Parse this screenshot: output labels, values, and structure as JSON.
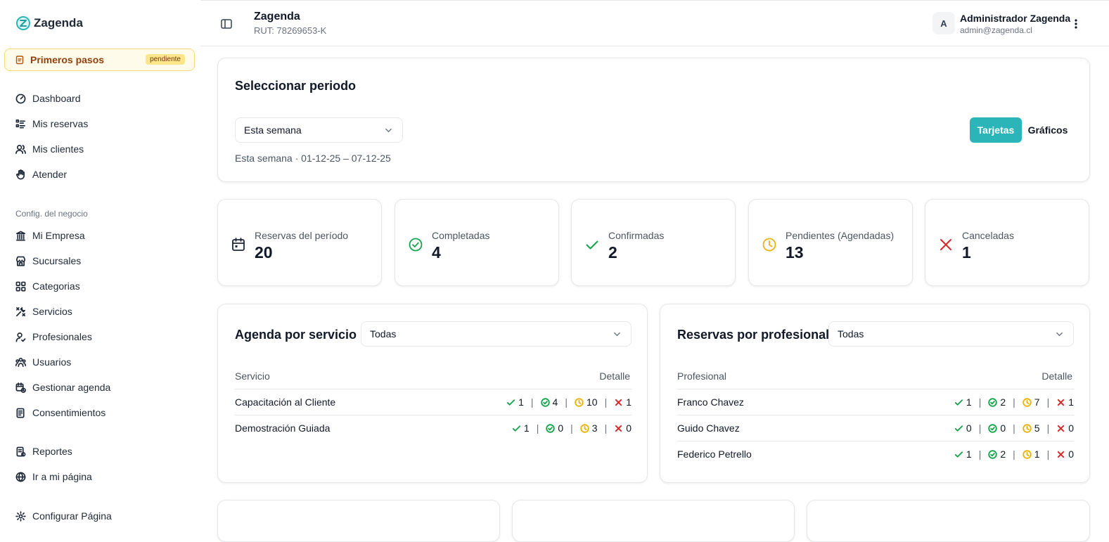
{
  "app": {
    "logo_text": "Zagenda"
  },
  "sidebar": {
    "first_steps": {
      "label": "Primeros pasos",
      "badge": "pendiente"
    },
    "main_items": [
      {
        "label": "Dashboard",
        "icon": "gauge-icon"
      },
      {
        "label": "Mis reservas",
        "icon": "list-icon"
      },
      {
        "label": "Mis clientes",
        "icon": "users-icon"
      },
      {
        "label": "Atender",
        "icon": "hand-icon"
      }
    ],
    "config_label": "Config. del negocio",
    "config_items": [
      {
        "label": "Mi Empresa",
        "icon": "building-icon"
      },
      {
        "label": "Sucursales",
        "icon": "store-icon"
      },
      {
        "label": "Categorias",
        "icon": "grid-icon"
      },
      {
        "label": "Servicios",
        "icon": "tools-icon"
      },
      {
        "label": "Profesionales",
        "icon": "user-check-icon"
      },
      {
        "label": "Usuarios",
        "icon": "people-icon"
      },
      {
        "label": "Gestionar agenda",
        "icon": "calendar-clock-icon"
      },
      {
        "label": "Consentimientos",
        "icon": "document-icon"
      }
    ],
    "bottom_items": [
      {
        "label": "Reportes",
        "icon": "report-icon"
      },
      {
        "label": "Ir a mi página",
        "icon": "globe-icon"
      },
      {
        "label": "Configurar Página",
        "icon": "gear-icon"
      }
    ]
  },
  "header": {
    "business_name": "Zagenda",
    "rut": "RUT: 78269653-K",
    "user_initial": "A",
    "user_name": "Administrador Zagenda",
    "user_email": "admin@zagenda.cl"
  },
  "period": {
    "title": "Seleccionar periodo",
    "selected": "Esta semana",
    "range_text": "Esta semana · 01-12-25 – 07-12-25",
    "view_toggle": {
      "active": "Tarjetas",
      "inactive": "Gráficos"
    }
  },
  "stats": [
    {
      "label": "Reservas del período",
      "value": "20",
      "icon": "calendar-icon",
      "color": "#1f2937"
    },
    {
      "label": "Completadas",
      "value": "4",
      "icon": "check-circle-icon",
      "color": "#16a34a"
    },
    {
      "label": "Confirmadas",
      "value": "2",
      "icon": "check-icon",
      "color": "#16a34a"
    },
    {
      "label": "Pendientes (Agendadas)",
      "value": "13",
      "icon": "clock-icon",
      "color": "#eab308"
    },
    {
      "label": "Canceladas",
      "value": "1",
      "icon": "x-icon",
      "color": "#dc2626"
    }
  ],
  "service_table": {
    "title": "Agenda por servicio",
    "filter": "Todas",
    "col_name": "Servicio",
    "col_detail": "Detalle",
    "rows": [
      {
        "name": "Capacitación al Cliente",
        "confirmed": "1",
        "completed": "4",
        "pending": "10",
        "cancelled": "1"
      },
      {
        "name": "Demostración Guiada",
        "confirmed": "1",
        "completed": "0",
        "pending": "3",
        "cancelled": "0"
      }
    ]
  },
  "pro_table": {
    "title": "Reservas por profesional",
    "filter": "Todas",
    "col_name": "Profesional",
    "col_detail": "Detalle",
    "rows": [
      {
        "name": "Franco Chavez",
        "confirmed": "1",
        "completed": "2",
        "pending": "7",
        "cancelled": "1"
      },
      {
        "name": "Guido Chavez",
        "confirmed": "0",
        "completed": "0",
        "pending": "5",
        "cancelled": "0"
      },
      {
        "name": "Federico Petrello",
        "confirmed": "1",
        "completed": "2",
        "pending": "1",
        "cancelled": "0"
      }
    ]
  },
  "colors": {
    "accent": "#2bb5b9",
    "success": "#16a34a",
    "warning": "#eab308",
    "danger": "#dc2626"
  }
}
